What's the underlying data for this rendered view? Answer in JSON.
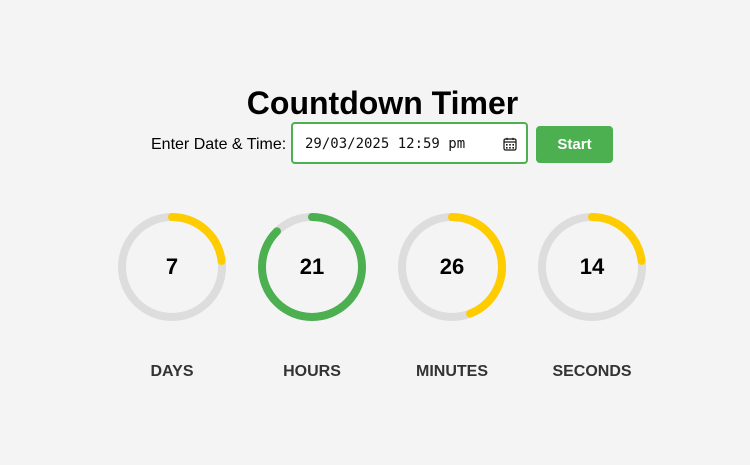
{
  "app": {
    "title": "Countdown Timer"
  },
  "form": {
    "label": "Enter Date & Time:",
    "datetime_value": "29/03/2025 12:59 pm",
    "picker_icon": "calendar-icon",
    "start_label": "Start"
  },
  "units": [
    {
      "label": "DAYS",
      "value": "7",
      "progress": 0.23,
      "color": "#ffcc00"
    },
    {
      "label": "HOURS",
      "value": "21",
      "progress": 0.875,
      "color": "#4caf50"
    },
    {
      "label": "MINUTES",
      "value": "26",
      "progress": 0.44,
      "color": "#ffcc00"
    },
    {
      "label": "SECONDS",
      "value": "14",
      "progress": 0.23,
      "color": "#ffcc00"
    }
  ],
  "colors": {
    "accent": "#4caf50",
    "warning": "#ffcc00",
    "track": "#dddddd",
    "background": "#f4f4f4"
  }
}
